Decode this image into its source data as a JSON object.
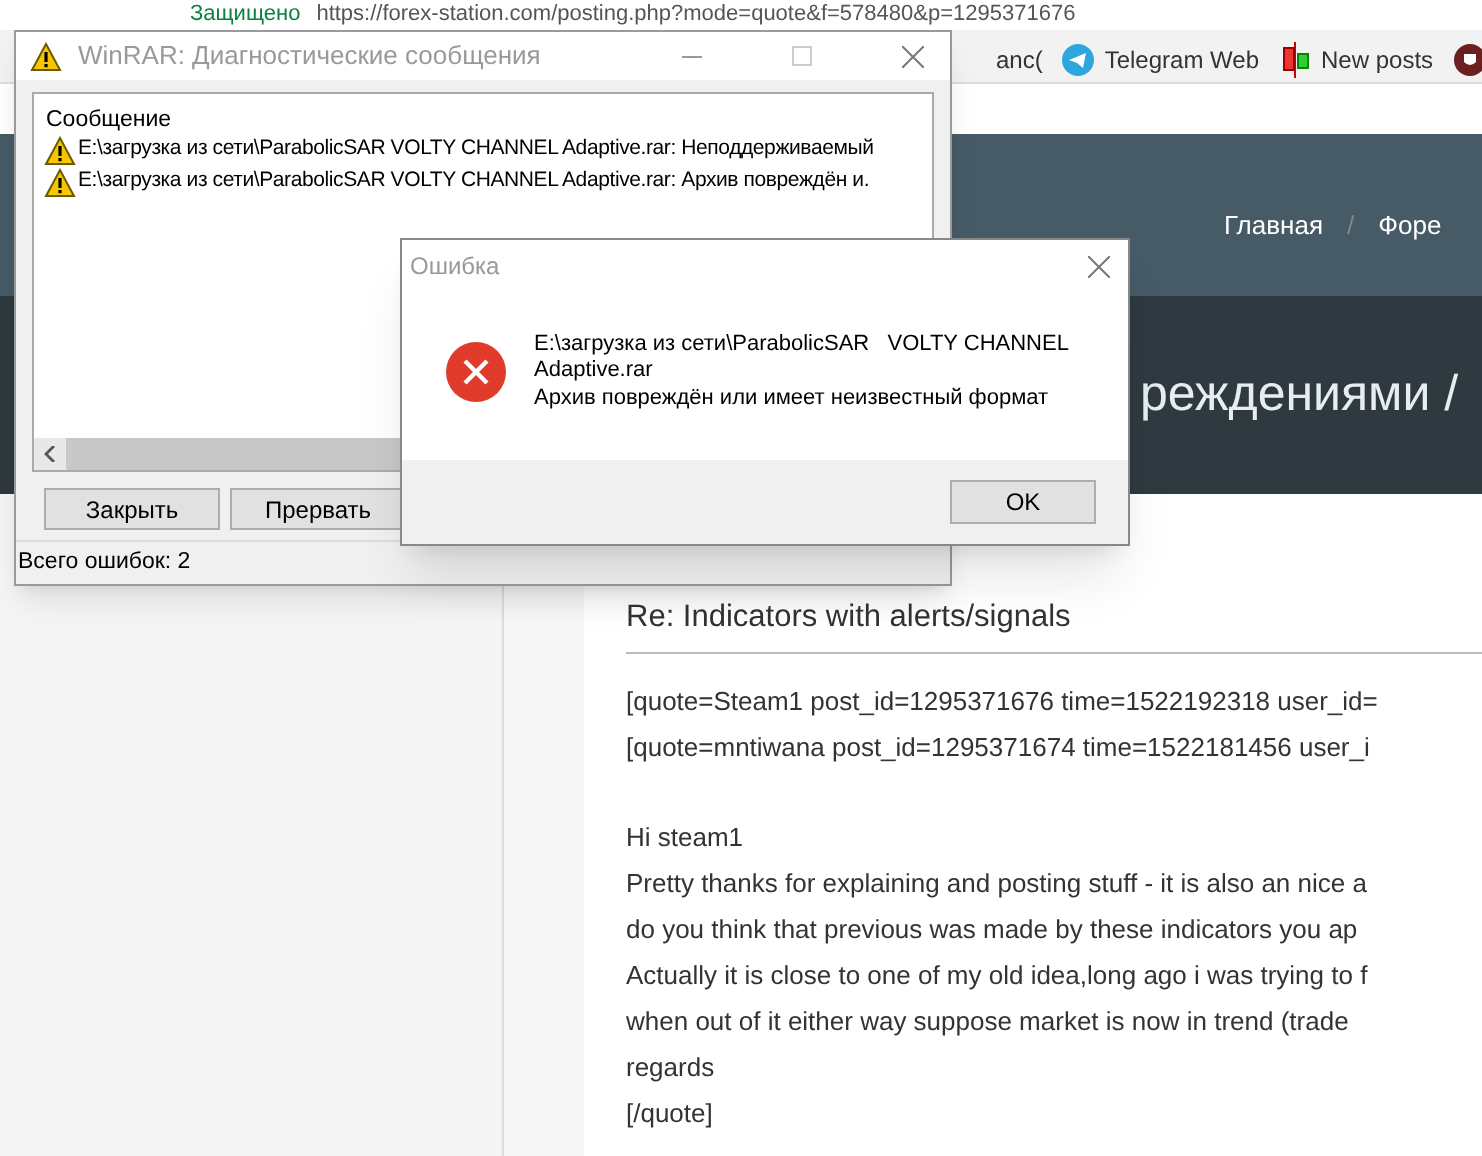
{
  "browser": {
    "security_label": "Защищено",
    "url": "https://forex-station.com/posting.php?mode=quote&f=578480&p=1295371676",
    "bookmarks": [
      {
        "label": "anc(",
        "kind": "text"
      },
      {
        "label": "Telegram Web",
        "kind": "telegram"
      },
      {
        "label": "New posts",
        "kind": "candles"
      },
      {
        "kind": "shield"
      }
    ]
  },
  "site": {
    "nav": [
      {
        "label": "Главная",
        "kind": "link"
      },
      {
        "label": "/",
        "kind": "separator"
      },
      {
        "label": "Форе",
        "kind": "link"
      }
    ],
    "heading": "реждениями /",
    "post": {
      "title": "Re: Indicators with alerts/signals",
      "quote_lines": [
        "[quote=Steam1 post_id=1295371676 time=1522192318 user_id=",
        "[quote=mntiwana post_id=1295371674 time=1522181456 user_i"
      ],
      "body_lines": [
        "Hi steam1",
        "Pretty thanks for explaining and posting stuff - it is also an nice a",
        "do you think that previous was made by these indicators you ap",
        "Actually it is close to one of my old idea,long ago i was trying to f",
        "when out of it either way suppose market is now in trend (trade",
        "regards",
        "[/quote]"
      ]
    }
  },
  "winrar": {
    "title": "WinRAR: Диагностические сообщения",
    "column": "Сообщение",
    "messages": [
      "E:\\загрузка из сети\\ParabolicSAR   VOLTY CHANNEL Adaptive.rar: Неподдерживаемый",
      "E:\\загрузка из сети\\ParabolicSAR   VOLTY CHANNEL Adaptive.rar: Архив повреждён и."
    ],
    "buttons": [
      "Закрыть",
      "Прервать"
    ],
    "status": "Всего ошибок: 2"
  },
  "error_dialog": {
    "title": "Ошибка",
    "message_lines": [
      "E:\\загрузка из сети\\ParabolicSAR   VOLTY CHANNEL",
      "Adaptive.rar",
      "Архив повреждён или имеет неизвестный формат"
    ],
    "button": "OK"
  }
}
